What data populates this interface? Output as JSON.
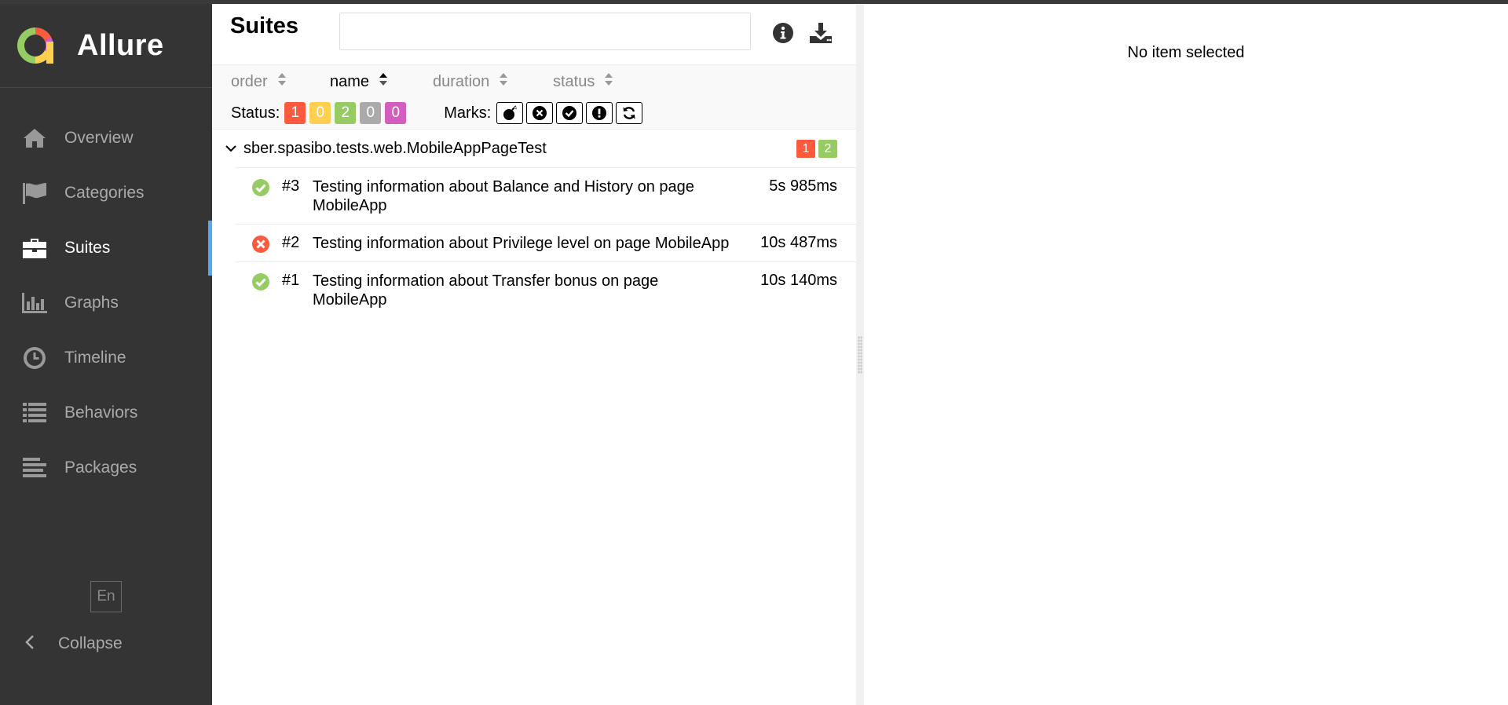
{
  "app": {
    "name": "Allure"
  },
  "colors": {
    "sidebar": "#343434",
    "accent": "#5aa7e6",
    "failed": "#fd5a3e",
    "broken": "#ffd050",
    "passed": "#97cc64",
    "skipped": "#aaaaaa",
    "unknown": "#d35ebe"
  },
  "sidebar": {
    "items": [
      {
        "label": "Overview",
        "icon": "home-icon"
      },
      {
        "label": "Categories",
        "icon": "flag-icon"
      },
      {
        "label": "Suites",
        "icon": "briefcase-icon",
        "active": true
      },
      {
        "label": "Graphs",
        "icon": "bar-chart-icon"
      },
      {
        "label": "Timeline",
        "icon": "clock-icon"
      },
      {
        "label": "Behaviors",
        "icon": "list-icon"
      },
      {
        "label": "Packages",
        "icon": "align-left-icon"
      }
    ],
    "language": "En",
    "collapse_label": "Collapse"
  },
  "pane": {
    "title": "Suites",
    "search_value": "",
    "sorters": [
      "order",
      "name",
      "duration",
      "status"
    ],
    "active_sorter": "name",
    "status_label": "Status:",
    "status_counts": {
      "failed": "1",
      "broken": "0",
      "passed": "2",
      "skipped": "0",
      "unknown": "0"
    },
    "marks_label": "Marks:",
    "marks": [
      "flaky-icon",
      "new-failed-icon",
      "new-passed-icon",
      "new-broken-icon",
      "retries-icon"
    ]
  },
  "group": {
    "name": "sber.spasibo.tests.web.MobileAppPageTest",
    "failed": "1",
    "passed": "2"
  },
  "tests": [
    {
      "status": "passed",
      "num": "#3",
      "name": "Testing information about Balance and History on page MobileApp",
      "duration": "5s 985ms"
    },
    {
      "status": "failed",
      "num": "#2",
      "name": "Testing information about Privilege level on page MobileApp",
      "duration": "10s 487ms"
    },
    {
      "status": "passed",
      "num": "#1",
      "name": "Testing information about Transfer bonus on page MobileApp",
      "duration": "10s 140ms"
    }
  ],
  "detail": {
    "empty_text": "No item selected"
  }
}
